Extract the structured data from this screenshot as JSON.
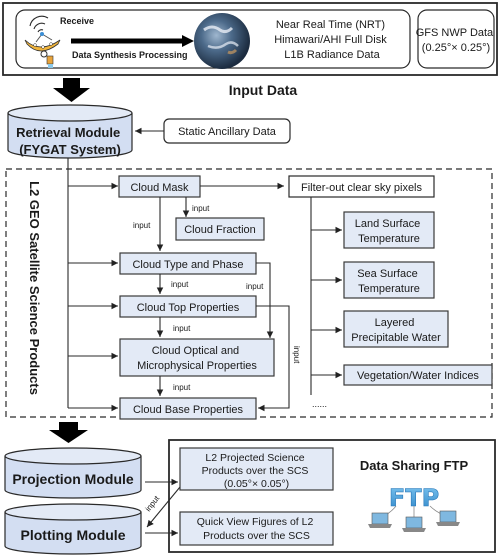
{
  "input_section": {
    "receive_label": "Receive",
    "process_label": "Data Synthesis Processing",
    "nrt_lines": [
      "Near Real Time (NRT)",
      "Himawari/AHI Full Disk",
      "L1B Radiance Data"
    ],
    "gfs_lines": [
      "GFS NWP Data",
      "(0.25°× 0.25°)"
    ],
    "caption": "Input Data"
  },
  "retrieval": {
    "lines": [
      "Retrieval Module",
      "(FYGAT System)"
    ],
    "ancillary": "Static Ancillary Data"
  },
  "products": {
    "vertical_title": "L2 GEO Satellite Science Products",
    "cloud_mask": "Cloud Mask",
    "cloud_fraction": "Cloud Fraction",
    "cloud_type": "Cloud Type and Phase",
    "cloud_top": "Cloud Top Properties",
    "cloud_optical_lines": [
      "Cloud Optical and",
      "Microphysical Properties"
    ],
    "cloud_base": "Cloud Base Properties",
    "filter": "Filter-out clear sky pixels",
    "lst_lines": [
      "Land Surface",
      "Temperature"
    ],
    "sst_lines": [
      "Sea Surface",
      "Temperature"
    ],
    "lpw_lines": [
      "Layered",
      "Precipitable Water"
    ],
    "veg": "Vegetation/Water Indices",
    "ellipsis": "......",
    "input_label": "input"
  },
  "output_section": {
    "projection": "Projection Module",
    "plotting": "Plotting Module",
    "projected_lines": [
      "L2 Projected Science",
      "Products over the SCS",
      "(0.05°× 0.05°)"
    ],
    "quickview_lines": [
      "Quick View Figures of L2",
      "Products over the SCS"
    ],
    "ftp_title": "Data Sharing FTP",
    "ftp_logo": "FTP"
  },
  "colors": {
    "box_fill": "#e3eaf6",
    "cylinder_fill": "#d3def2",
    "ftp_blue": "#3a9ad9"
  }
}
